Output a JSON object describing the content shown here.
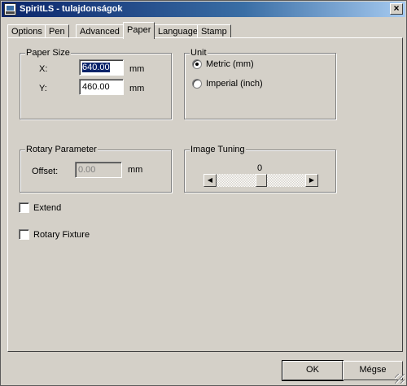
{
  "window": {
    "title": "SpiritLS - tulajdonságok",
    "close_symbol": "×"
  },
  "tabs": [
    {
      "label": "Options",
      "active": false
    },
    {
      "label": "Pen",
      "active": false
    },
    {
      "label": "Advanced",
      "active": false
    },
    {
      "label": "Paper",
      "active": true
    },
    {
      "label": "Language",
      "active": false
    },
    {
      "label": "Stamp",
      "active": false
    }
  ],
  "paper_size": {
    "legend": "Paper Size",
    "x_label": "X:",
    "x_value": "640.00",
    "x_unit": "mm",
    "y_label": "Y:",
    "y_value": "460.00",
    "y_unit": "mm"
  },
  "unit": {
    "legend": "Unit",
    "options": [
      {
        "label": "Metric (mm)",
        "selected": true
      },
      {
        "label": "Imperial (inch)",
        "selected": false
      }
    ]
  },
  "rotary_parameter": {
    "legend": "Rotary Parameter",
    "offset_label": "Offset:",
    "offset_value": "0.00",
    "offset_unit": "mm",
    "enabled": false
  },
  "image_tuning": {
    "legend": "Image Tuning",
    "value": "0",
    "left_arrow": "◀",
    "right_arrow": "▶"
  },
  "checkboxes": [
    {
      "label": "Extend",
      "checked": false
    },
    {
      "label": "Rotary Fixture",
      "checked": false
    }
  ],
  "buttons": {
    "ok": "OK",
    "cancel": "Mégse"
  }
}
